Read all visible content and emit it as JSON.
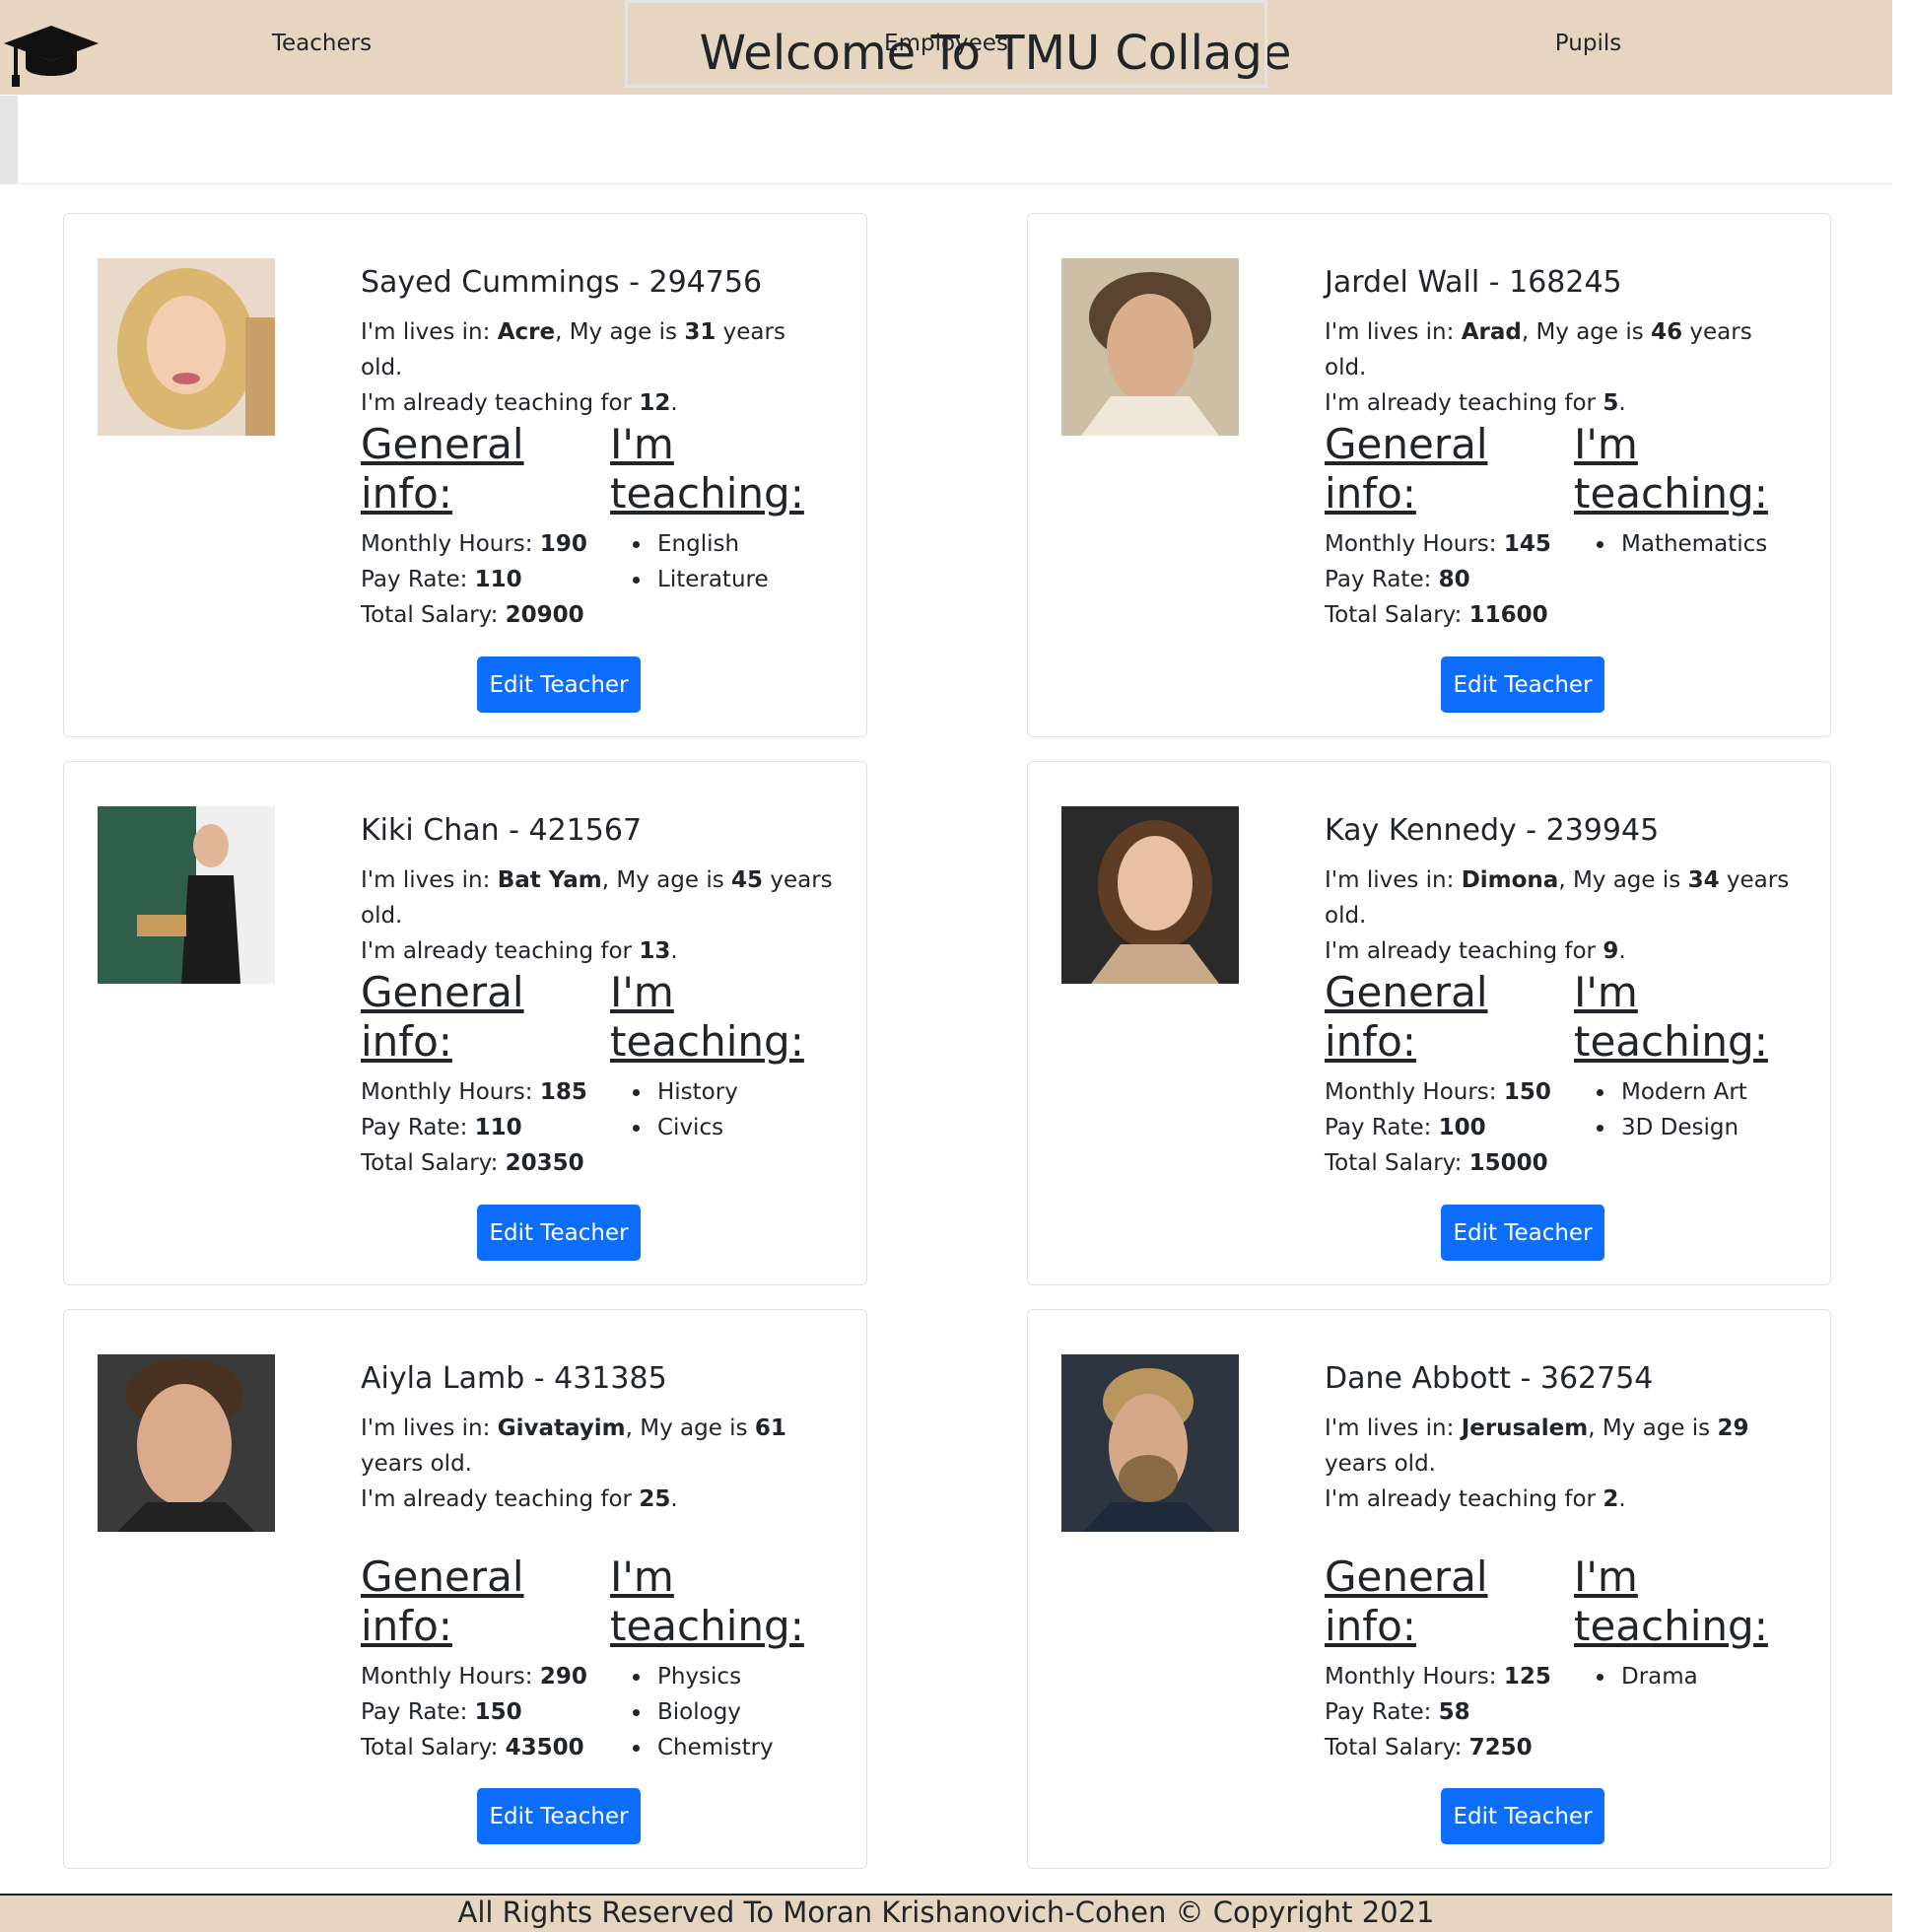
{
  "header": {
    "title": "Welcome To TMU Collage",
    "logo_icon": "graduation-cap-icon"
  },
  "tabs": [
    {
      "label": "Teachers"
    },
    {
      "label": "Employees"
    },
    {
      "label": "Pupils"
    }
  ],
  "labels": {
    "lives_prefix": "I'm lives in: ",
    "age_prefix": ", My age is ",
    "age_suffix": " years old.",
    "teaching_prefix": "I'm already teaching for ",
    "teaching_suffix": ".",
    "general_line1": "General",
    "general_line2": "info:",
    "teach_line1": "I'm",
    "teach_line2": "teaching:",
    "hours": "Monthly Hours: ",
    "rate": "Pay Rate: ",
    "salary": "Total Salary: ",
    "edit": "Edit Teacher"
  },
  "teachers": [
    {
      "name": "Sayed Cummings - 294756",
      "city": "Acre",
      "age": "31",
      "years": "12",
      "hours": "190",
      "rate": "110",
      "salary": "20900",
      "subjects": [
        "English",
        "Literature"
      ],
      "photo_icon": "portrait-woman-blonde"
    },
    {
      "name": "Jardel Wall - 168245",
      "city": "Arad",
      "age": "46",
      "years": "5",
      "hours": "145",
      "rate": "80",
      "salary": "11600",
      "subjects": [
        "Mathematics"
      ],
      "photo_icon": "portrait-man-dark-hair"
    },
    {
      "name": "Kiki Chan - 421567",
      "city": "Bat Yam",
      "age": "45",
      "years": "13",
      "hours": "185",
      "rate": "110",
      "salary": "20350",
      "subjects": [
        "History",
        "Civics"
      ],
      "photo_icon": "portrait-teacher-chalkboard"
    },
    {
      "name": "Kay Kennedy - 239945",
      "city": "Dimona",
      "age": "34",
      "years": "9",
      "hours": "150",
      "rate": "100",
      "salary": "15000",
      "subjects": [
        "Modern Art",
        "3D Design"
      ],
      "photo_icon": "portrait-girl-brown-hair"
    },
    {
      "name": "Aiyla Lamb - 431385",
      "city": "Givatayim",
      "age": "61",
      "years": "25",
      "hours": "290",
      "rate": "150",
      "salary": "43500",
      "subjects": [
        "Physics",
        "Biology",
        "Chemistry"
      ],
      "photo_icon": "portrait-man-short-hair"
    },
    {
      "name": "Dane Abbott - 362754",
      "city": "Jerusalem",
      "age": "29",
      "years": "2",
      "hours": "125",
      "rate": "58",
      "salary": "7250",
      "subjects": [
        "Drama"
      ],
      "photo_icon": "portrait-man-beard"
    }
  ],
  "footer": {
    "text": "All Rights Reserved To Moran Krishanovich-Cohen © Copyright 2021"
  }
}
